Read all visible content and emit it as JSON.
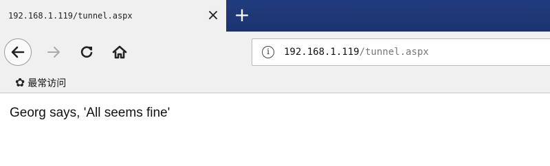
{
  "tab": {
    "title": "192.168.1.119/tunnel.aspx",
    "close_glyph": "×",
    "new_tab_glyph": "+"
  },
  "navbar": {
    "back_icon": "back-arrow-icon",
    "forward_icon": "forward-arrow-icon",
    "reload_icon": "reload-icon",
    "home_icon": "home-icon",
    "url_host": "192.168.1.119",
    "url_path": "/tunnel.aspx",
    "info_glyph": "i"
  },
  "bookmarks": {
    "item_label": "最常访问",
    "item_icon": "gear-icon"
  },
  "page": {
    "message": "Georg says, 'All seems fine'"
  },
  "colors": {
    "tabbar_bg": "#1f3a7a",
    "chrome_bg": "#f0f0f0"
  }
}
